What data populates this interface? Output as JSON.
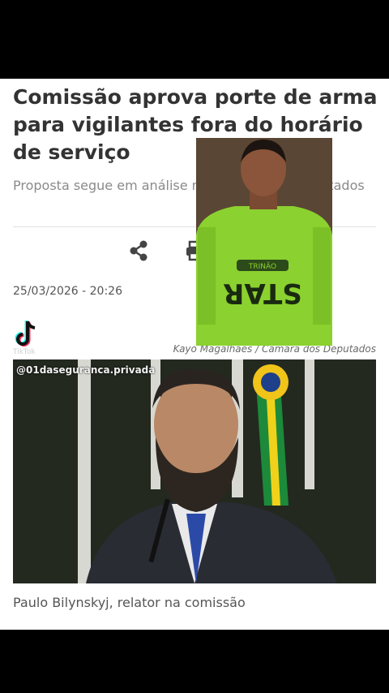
{
  "article": {
    "headline": "Comissão aprova porte de arma para vigilantes fora do horário de serviço",
    "subhead": "Proposta segue em análise na Câmara dos Deputados",
    "date": "25/03/2026 - 20:26",
    "photo_credit": "Kayo Magalhães / Câmara dos Deputados",
    "photo_caption": "Paulo Bilynskyj, relator na comissão"
  },
  "video": {
    "watermark": "@01daseguranca.privada",
    "overlay_shirt_text": "STAR",
    "overlay_shirt_badge": "TRINÃO"
  },
  "icons": {
    "share": "share-icon",
    "print": "print-icon",
    "tiktok": "tiktok-logo"
  },
  "colors": {
    "page_bg": "#000000",
    "card_bg": "#ffffff",
    "headline": "#333333",
    "shirt_green": "#8bd12f"
  }
}
